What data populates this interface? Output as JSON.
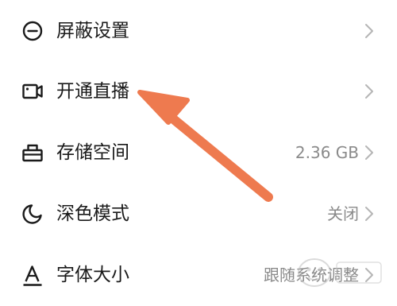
{
  "settings": {
    "items": [
      {
        "label": "屏蔽设置",
        "value": "",
        "icon": "block-icon"
      },
      {
        "label": "开通直播",
        "value": "",
        "icon": "video-camera-icon"
      },
      {
        "label": "存储空间",
        "value": "2.36 GB",
        "icon": "storage-icon"
      },
      {
        "label": "深色模式",
        "value": "关闭",
        "icon": "moon-icon"
      },
      {
        "label": "字体大小",
        "value": "跟随系统调整",
        "icon": "font-size-icon"
      }
    ]
  },
  "annotation": {
    "arrow_color": "#ee7a4f",
    "arrow_target": "开通直播"
  },
  "colors": {
    "text_primary": "#1a1a1a",
    "text_secondary": "#8a8a8a",
    "chevron": "#b5b5b5",
    "background": "#ffffff"
  }
}
